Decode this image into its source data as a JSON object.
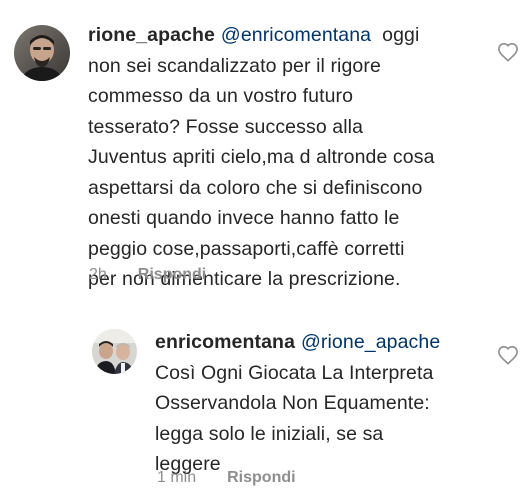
{
  "comments": [
    {
      "username": "rione_apache",
      "mention": "@enricomentana",
      "lines": [
        "oggi",
        "non sei scandalizzato per il rigore",
        "commesso da un vostro futuro",
        "tesserato? Fosse successo alla",
        "Juventus apriti cielo,ma d altronde cosa",
        "aspettarsi da coloro che si definiscono",
        "onesti quando invece hanno fatto le",
        "peggio cose,passaporti,caffè corretti",
        "per non dimenticare la prescrizione."
      ],
      "time": "2h",
      "reply_label": "Rispondi",
      "like_icon": "heart-outline-icon"
    },
    {
      "username": "enricomentana",
      "mention": "@rione_apache",
      "lines": [
        "Così Ogni Giocata La Interpreta",
        "Osservandola Non Equamente:",
        "legga solo le iniziali, se sa",
        "leggere"
      ],
      "time": "1 min",
      "reply_label": "Rispondi",
      "like_icon": "heart-outline-icon"
    }
  ],
  "colors": {
    "text": "#262626",
    "mention": "#003569",
    "meta": "#8e8e8e"
  }
}
